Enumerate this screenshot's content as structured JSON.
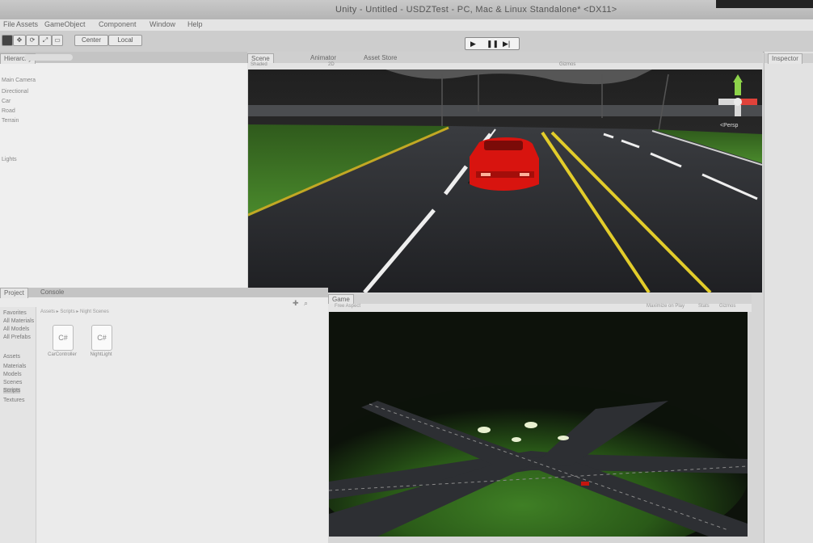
{
  "window": {
    "title": "Unity - Untitled - USDZTest - PC, Mac & Linux Standalone* <DX11>"
  },
  "menu": [
    "File",
    "Assets",
    "GameObject",
    "Component",
    "Window",
    "Help"
  ],
  "toolbar": {
    "pivot_label": "Center",
    "space_label": "Local"
  },
  "play": {
    "play": "▶",
    "pause": "❚❚",
    "step": "▶|"
  },
  "scene_tabs": {
    "scene": "Scene",
    "animator": "Animator",
    "asset_store": "Asset Store"
  },
  "scene_toolbar": {
    "shaded": "Shaded",
    "mode": "2D",
    "gizmos": "Gizmos"
  },
  "gizmo": {
    "label": "<Persp"
  },
  "hierarchy": {
    "tab": "Hierarchy",
    "items": [
      "Main Camera",
      "Directional",
      "Car",
      "Road",
      "Terrain",
      "Lights"
    ]
  },
  "project": {
    "tabs": [
      "Project",
      "Console"
    ],
    "breadcrumb": "Assets ▸ Scripts ▸ Night Scenes",
    "tree": [
      "Favorites",
      "All Materials",
      "All Models",
      "All Prefabs",
      "Assets",
      "Materials",
      "Models",
      "Scenes",
      "Scripts",
      "Textures"
    ],
    "assets": [
      {
        "icon": "C#",
        "name": "CarController"
      },
      {
        "icon": "C#",
        "name": "NightLight"
      }
    ]
  },
  "game": {
    "tab": "Game",
    "aspect": "Free Aspect",
    "toolbar": [
      "Maximize on Play",
      "Stats",
      "Gizmos"
    ]
  },
  "inspector": {
    "tab": "Inspector"
  },
  "colors": {
    "car": "#e11a14",
    "grass": "#3f7a24",
    "road": "#2a2b2e",
    "line_yellow": "#e2cc2a"
  }
}
